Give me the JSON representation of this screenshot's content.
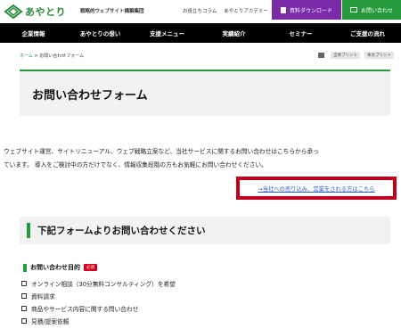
{
  "header": {
    "logo_text": "あやとり",
    "tagline": "戦略的ウェブサイト構築集団",
    "links": [
      "お役立ちコラム",
      "あやとりアカデミー"
    ],
    "download_label": "資料ダウンロード",
    "contact_label": "お問い合わせ",
    "brand_color": "#249a3a",
    "download_color": "#7b2aa8"
  },
  "nav": {
    "items": [
      "企業情報",
      "あやとりの想い",
      "支援メニュー",
      "実績紹介",
      "セミナー",
      "ご支援の流れ"
    ]
  },
  "breadcrumb": {
    "home": "ホーム",
    "separator": ">",
    "current": "お問い合わせフォーム"
  },
  "print_tools": {
    "all_print": "全体プリント",
    "body_print": "本文プリント"
  },
  "page_title": "お問い合わせフォーム",
  "intro": {
    "line1": "ウェブサイト運営、サイトリニューアル、ウェブ戦略立案など、当社サービスに関するお問い合わせはこちらから承っ",
    "line2": "ています。 導入をご検討中の方だけでなく、情報収集段階の方もお気軽にお問い合わせください。"
  },
  "sales_link": "→当社への売り込み、営業をされる方はこちら",
  "form": {
    "heading": "下記フォームよりお問い合わせください",
    "purpose_label": "お問い合わせ目的",
    "required_badge": "必須",
    "options": [
      "オンライン相談（30分無料コンサルティング）を希望",
      "資料請求",
      "商品やサービス内容に関する問い合わせ",
      "見積/提案依頼"
    ]
  }
}
